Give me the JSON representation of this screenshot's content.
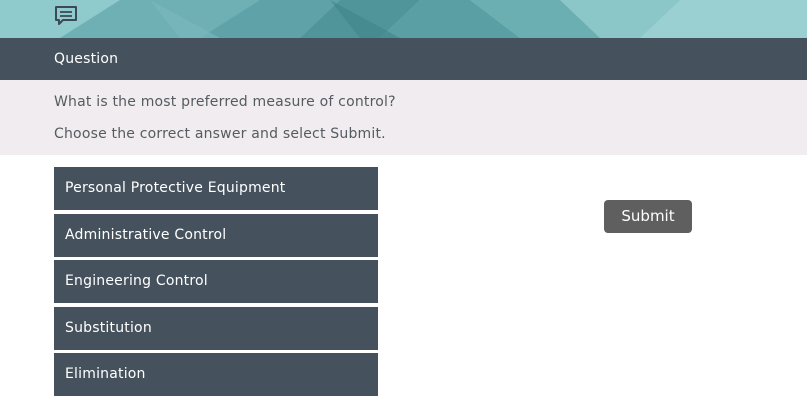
{
  "banner": {
    "icon": "chat-icon",
    "color": "#7cbcc0"
  },
  "header": {
    "title": "Question"
  },
  "prompt": {
    "question": "What is the most preferred measure of control?",
    "instruction": "Choose the correct answer and select Submit."
  },
  "options": [
    {
      "label": "Personal Protective Equipment"
    },
    {
      "label": "Administrative Control"
    },
    {
      "label": "Engineering Control"
    },
    {
      "label": "Substitution"
    },
    {
      "label": "Elimination"
    }
  ],
  "submit": {
    "label": "Submit"
  },
  "colors": {
    "header_bg": "#45525d",
    "prompt_bg": "#f0ecef",
    "option_bg": "#45525d",
    "submit_bg": "#5f5f5f"
  }
}
